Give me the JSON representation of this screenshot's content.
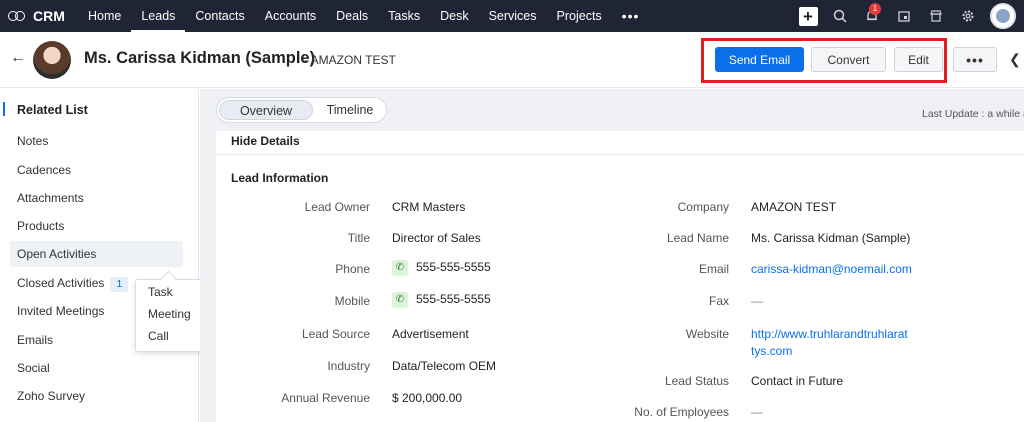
{
  "topnav": {
    "brand": "CRM",
    "items": [
      "Home",
      "Leads",
      "Contacts",
      "Accounts",
      "Deals",
      "Tasks",
      "Desk",
      "Services",
      "Projects"
    ],
    "active": "Leads",
    "more": "•••",
    "notification_count": "1",
    "icons": [
      "plus-icon",
      "search-icon",
      "bell-icon",
      "calendar-icon",
      "store-icon",
      "gear-icon",
      "avatar"
    ]
  },
  "record": {
    "name": "Ms. Carissa Kidman (Sample)",
    "company_suffix": "- AMAZON TEST",
    "buttons": {
      "send_email": "Send Email",
      "convert": "Convert",
      "edit": "Edit",
      "more": "•••"
    }
  },
  "sidebar": {
    "heading": "Related List",
    "items": [
      "Notes",
      "Cadences",
      "Attachments",
      "Products",
      "Open Activities",
      "Closed Activities",
      "Invited Meetings",
      "Emails",
      "Social",
      "Zoho Survey"
    ],
    "closed_activities_count": "1",
    "popup": [
      "Task",
      "Meeting",
      "Call"
    ]
  },
  "main": {
    "tabs": [
      "Overview",
      "Timeline"
    ],
    "active_tab": "Overview",
    "last_update": "Last Update : a while ago",
    "hide_details": "Hide Details",
    "section_title": "Lead Information",
    "left_fields": [
      {
        "label": "Lead Owner",
        "value": "CRM Masters"
      },
      {
        "label": "Title",
        "value": "Director of Sales"
      },
      {
        "label": "Phone",
        "value": "555-555-5555"
      },
      {
        "label": "Mobile",
        "value": "555-555-5555"
      },
      {
        "label": "Lead Source",
        "value": "Advertisement"
      },
      {
        "label": "Industry",
        "value": "Data/Telecom OEM"
      },
      {
        "label": "Annual Revenue",
        "value": "$ 200,000.00"
      }
    ],
    "right_fields": [
      {
        "label": "Company",
        "value": "AMAZON TEST"
      },
      {
        "label": "Lead Name",
        "value": "Ms. Carissa Kidman (Sample)"
      },
      {
        "label": "Email",
        "value": "carissa-kidman@noemail.com"
      },
      {
        "label": "Fax",
        "value": "—"
      },
      {
        "label": "Website",
        "value_line1": "http://www.truhlarandtruhlarat",
        "value_line2": "tys.com"
      },
      {
        "label": "Lead Status",
        "value": "Contact in Future"
      },
      {
        "label": "No. of Employees",
        "value": "—"
      }
    ]
  }
}
